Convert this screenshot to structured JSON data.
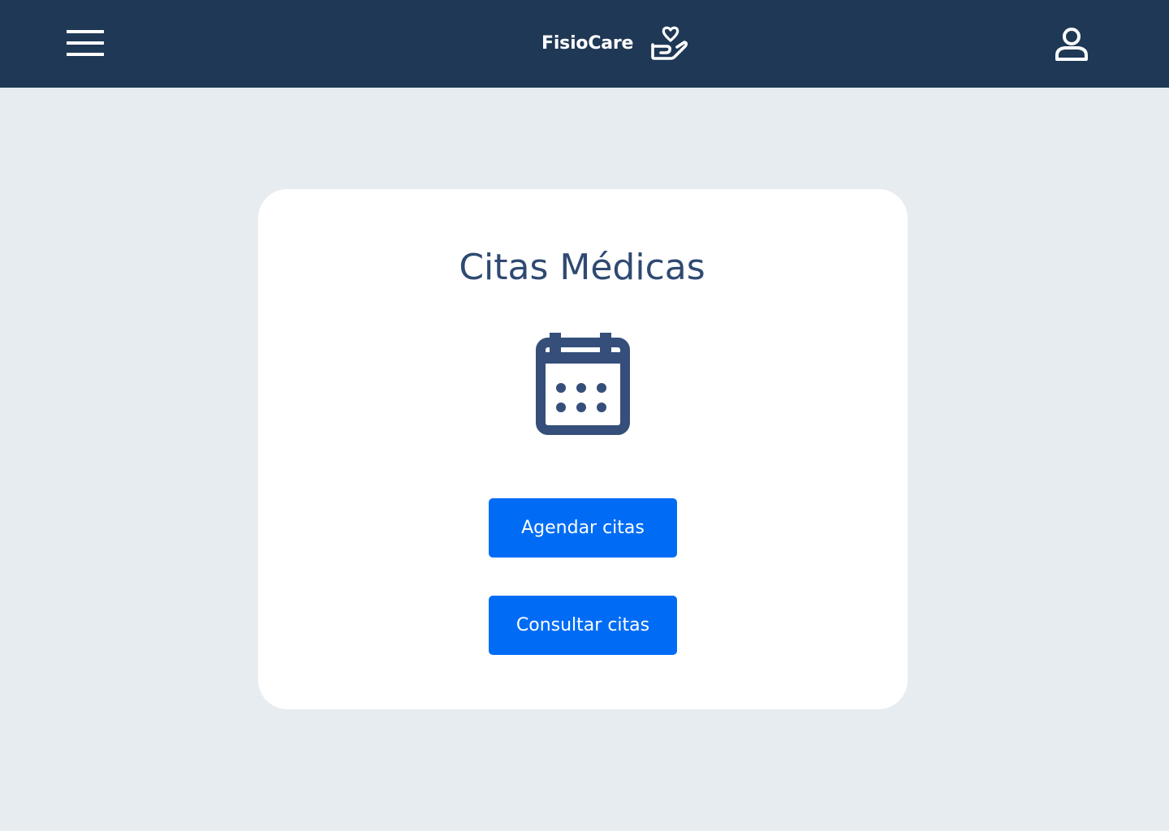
{
  "header": {
    "app_name": "FisioCare",
    "menu_icon": "hamburger-menu-icon",
    "logo_icon": "hand-heart-icon",
    "user_icon": "user-account-icon",
    "background_color": "#1f3856"
  },
  "card": {
    "title": "Citas Médicas",
    "icon": "calendar-icon",
    "actions": [
      {
        "label": "Agendar citas"
      },
      {
        "label": "Consultar citas"
      }
    ]
  },
  "colors": {
    "page_background": "#e7ecf1",
    "primary_button": "#006cf5",
    "title_text": "#2f4a72"
  }
}
